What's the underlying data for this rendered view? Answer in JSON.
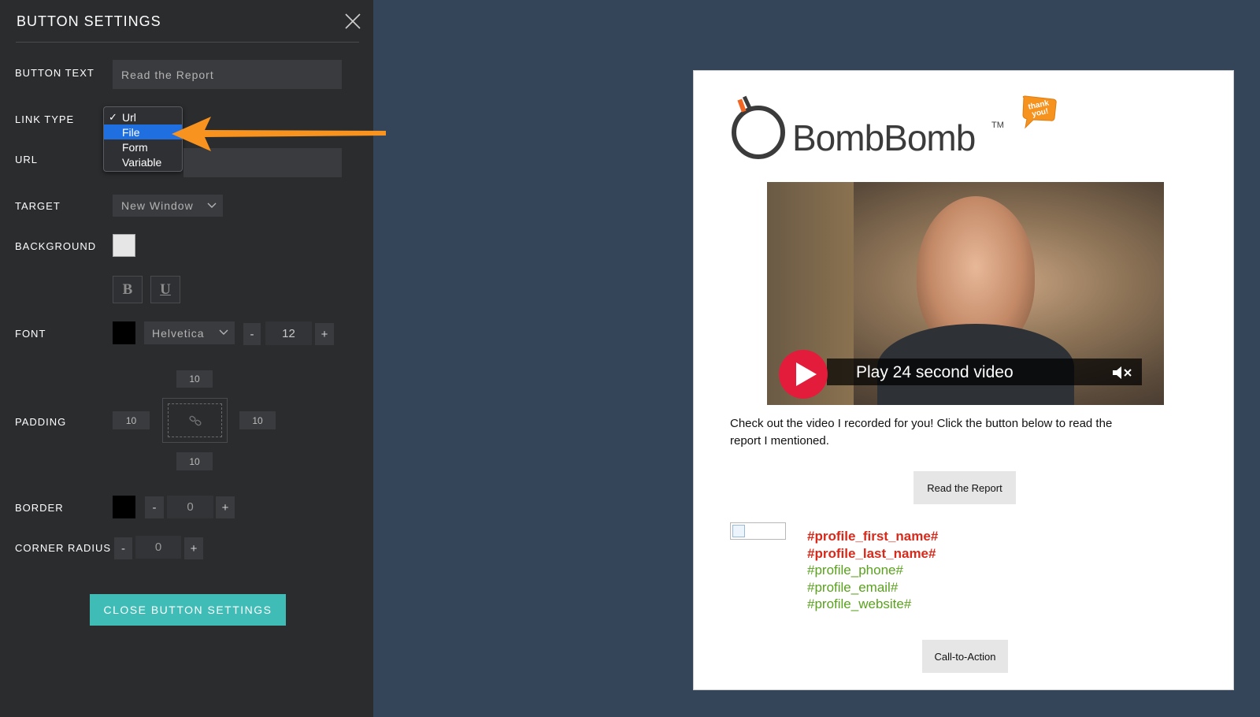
{
  "panel": {
    "title": "BUTTON SETTINGS",
    "button_text": {
      "label": "BUTTON TEXT",
      "value": "Read the Report"
    },
    "link_type": {
      "label": "LINK TYPE",
      "options": [
        {
          "label": "Url",
          "checked": true
        },
        {
          "label": "File",
          "highlighted": true
        },
        {
          "label": "Form"
        },
        {
          "label": "Variable"
        }
      ]
    },
    "url": {
      "label": "URL",
      "value": ""
    },
    "target": {
      "label": "TARGET",
      "value": "New Window"
    },
    "background": {
      "label": "BACKGROUND",
      "color": "#e6e6e6"
    },
    "style_buttons": {
      "bold": "B",
      "underline": "U"
    },
    "font": {
      "label": "FONT",
      "color": "#000000",
      "family": "Helvetica",
      "size": "12",
      "minus": "-",
      "plus": "+"
    },
    "padding": {
      "label": "PADDING",
      "top": "10",
      "left": "10",
      "right": "10",
      "bottom": "10"
    },
    "border": {
      "label": "BORDER",
      "color": "#000000",
      "value": "0",
      "minus": "-",
      "plus": "+"
    },
    "corner_radius": {
      "label": "CORNER RADIUS",
      "value": "0",
      "minus": "-",
      "plus": "+"
    },
    "close_button": "CLOSE BUTTON SETTINGS",
    "accent_color": "#3fbcb6"
  },
  "email": {
    "brand": "BombBomb",
    "trademark": "TM",
    "badge_text": "thank you!",
    "video_caption": "Play 24 second video",
    "body_text": "Check out the video I recorded for you! Click the button below to read the report I mentioned.",
    "primary_button": "Read the Report",
    "signature": {
      "first_name": "#profile_first_name#",
      "last_name": "#profile_last_name#",
      "phone": "#profile_phone#",
      "email": "#profile_email#",
      "website": "#profile_website#"
    },
    "cta_button": "Call-to-Action"
  }
}
